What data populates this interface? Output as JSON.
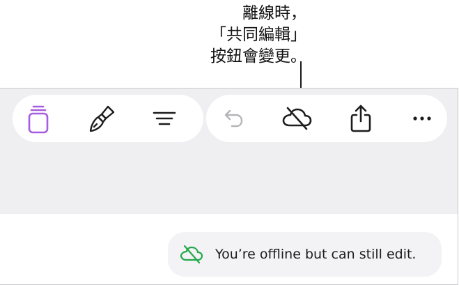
{
  "callout": {
    "line1": "離線時，",
    "line2": "「共同編輯」",
    "line3": "按鈕會變更。"
  },
  "toolbar": {
    "left_buttons": [
      "document",
      "format-brush",
      "view-options"
    ],
    "right_buttons": [
      "undo",
      "collaborate-offline",
      "share",
      "more"
    ]
  },
  "toast": {
    "message": "You’re offline but can still edit.",
    "icon": "cloud-offline-icon"
  },
  "colors": {
    "accent": "#a65ee0",
    "offline_green": "#23a84a",
    "icon": "#1c1c1e",
    "icon_disabled": "#b4b4b9",
    "toolbar_bg": "#efeff2"
  }
}
